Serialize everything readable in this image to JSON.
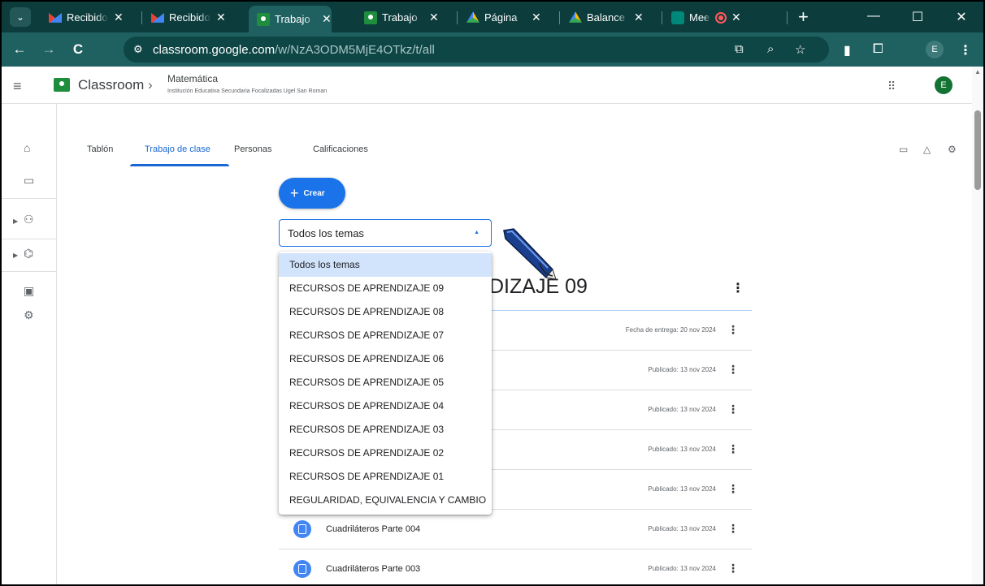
{
  "browser": {
    "tabs": [
      {
        "label": "Recibido",
        "favicon": "gmail-icon"
      },
      {
        "label": "Recibido",
        "favicon": "gmail-icon"
      },
      {
        "label": "Trabajo",
        "favicon": "classroom-icon",
        "active": true
      },
      {
        "label": "Trabajo",
        "favicon": "classroom-icon"
      },
      {
        "label": "Página",
        "favicon": "drive-icon"
      },
      {
        "label": "Balance",
        "favicon": "drive-icon"
      },
      {
        "label": "Mee",
        "favicon": "meet-icon",
        "recording": true
      }
    ],
    "close_glyph": "✕",
    "url_host": "classroom.google.com",
    "url_path": "/w/NzA3ODM5MjE4OTkz/t/all",
    "profile_initial": "E"
  },
  "header": {
    "app_title": "Classroom",
    "class_name": "Matemática",
    "class_subtitle": "Institución Educativa Secundaria Focalizadas Ugel San Roman",
    "avatar_initial": "E"
  },
  "tabs": {
    "stream": "Tablón",
    "classwork": "Trabajo de clase",
    "people": "Personas",
    "grades": "Calificaciones"
  },
  "create_button": {
    "label": "Crear"
  },
  "topic_filter": {
    "selected": "Todos los temas",
    "options": [
      "Todos los temas",
      "RECURSOS DE APRENDIZAJE 09",
      "RECURSOS DE APRENDIZAJE 08",
      "RECURSOS DE APRENDIZAJE 07",
      "RECURSOS DE APRENDIZAJE 06",
      "RECURSOS DE APRENDIZAJE 05",
      "RECURSOS DE APRENDIZAJE 04",
      "RECURSOS DE APRENDIZAJE 03",
      "RECURSOS DE APRENDIZAJE 02",
      "RECURSOS DE APRENDIZAJE 01",
      "REGULARIDAD, EQUIVALENCIA Y CAMBIO"
    ]
  },
  "section": {
    "title_visible": "DIZAJE 09",
    "rows": [
      {
        "title": "",
        "meta": "Fecha de entrega: 20 nov 2024"
      },
      {
        "title": "",
        "meta": "Publicado: 13 nov 2024"
      },
      {
        "title": "",
        "meta": "Publicado: 13 nov 2024"
      },
      {
        "title": "",
        "meta": "Publicado: 13 nov 2024"
      },
      {
        "title": "",
        "meta": "Publicado: 13 nov 2024"
      },
      {
        "title": "Cuadriláteros Parte 004",
        "meta": "Publicado: 13 nov 2024"
      },
      {
        "title": "Cuadriláteros Parte 003",
        "meta": "Publicado: 13 nov 2024"
      }
    ]
  },
  "colors": {
    "tabstrip": "#0c3c3c",
    "toolbar": "#1f6161",
    "accent": "#1a73e8",
    "selected_option": "#d2e3fc"
  }
}
